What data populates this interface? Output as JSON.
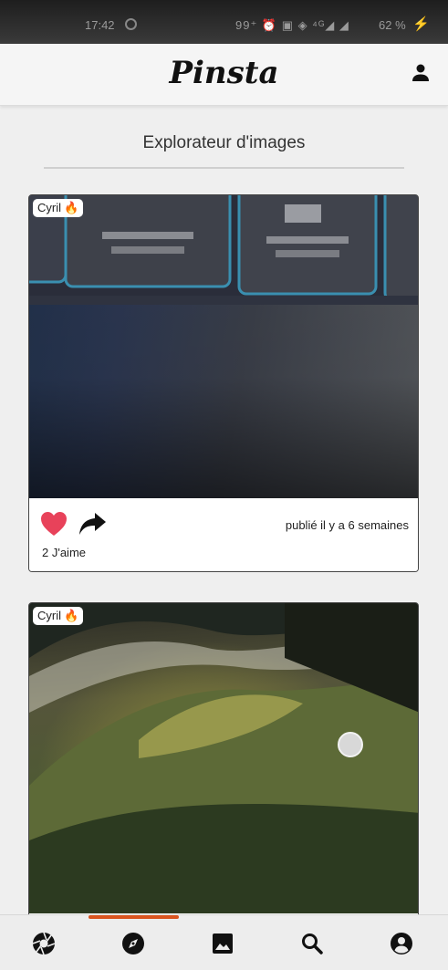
{
  "status_bar": {
    "time": "17:42",
    "icons": "99⁺ ⏰ ▣ ◈ ⁴ᴳ◢ ◢",
    "battery": "62 %"
  },
  "app": {
    "name": "Pinsta"
  },
  "page": {
    "title": "Explorateur d'images"
  },
  "posts": [
    {
      "author": "Cyril",
      "author_icon": "🔥",
      "date": "publié il y a 6 semaines",
      "likes": "2 J'aime",
      "liked": true
    },
    {
      "author": "Cyril",
      "author_icon": "🔥"
    }
  ],
  "nav": {
    "items": [
      "feed-icon",
      "explore-icon",
      "gallery-icon",
      "search-icon",
      "account-icon"
    ],
    "active": "explore-icon"
  },
  "colors": {
    "accent": "#d9541e",
    "like": "#e8425a"
  }
}
